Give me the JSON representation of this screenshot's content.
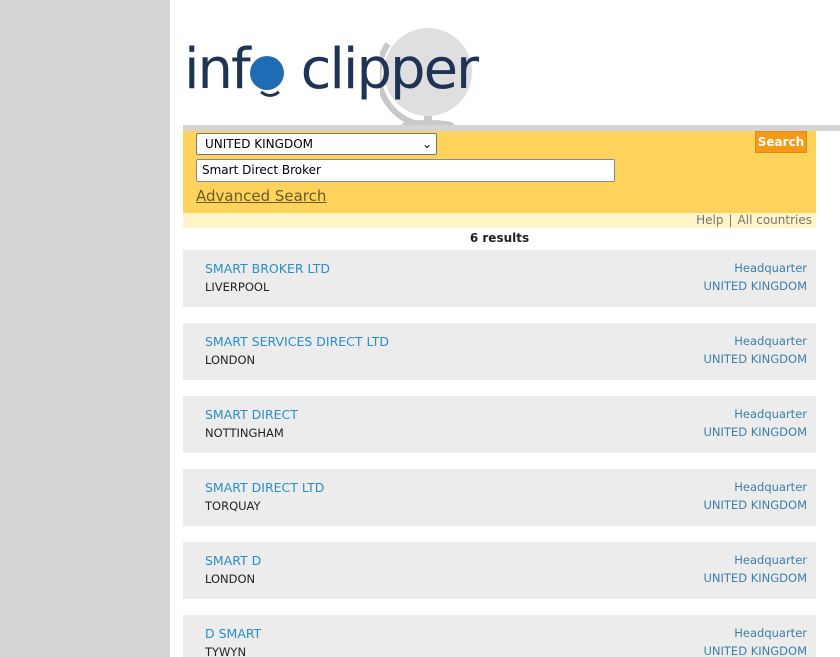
{
  "logo": {
    "part1": "inf",
    "part2": "clipper"
  },
  "search": {
    "country_selected": "UNITED KINGDOM",
    "query_value": "Smart Direct Broker",
    "search_button": "Search",
    "advanced_link": "Advanced Search"
  },
  "help_strip": {
    "help": "Help",
    "separator": "|",
    "all_countries": "All countries"
  },
  "results_summary": "6 results",
  "results": [
    {
      "name": "SMART BROKER LTD",
      "city": "LIVERPOOL",
      "type": "Headquarter",
      "country": "UNITED KINGDOM"
    },
    {
      "name": "SMART SERVICES DIRECT LTD",
      "city": "LONDON",
      "type": "Headquarter",
      "country": "UNITED KINGDOM"
    },
    {
      "name": "SMART DIRECT",
      "city": "NOTTINGHAM",
      "type": "Headquarter",
      "country": "UNITED KINGDOM"
    },
    {
      "name": "SMART DIRECT LTD",
      "city": "TORQUAY",
      "type": "Headquarter",
      "country": "UNITED KINGDOM"
    },
    {
      "name": "SMART D",
      "city": "LONDON",
      "type": "Headquarter",
      "country": "UNITED KINGDOM"
    },
    {
      "name": "D SMART",
      "city": "TYWYN",
      "type": "Headquarter",
      "country": "UNITED KINGDOM"
    }
  ],
  "colors": {
    "brand_navy": "#1f3454",
    "brand_blue": "#1f6cb4",
    "search_panel": "#fdd35c",
    "search_button": "#f49a15",
    "link_blue": "#2b8ec6"
  }
}
